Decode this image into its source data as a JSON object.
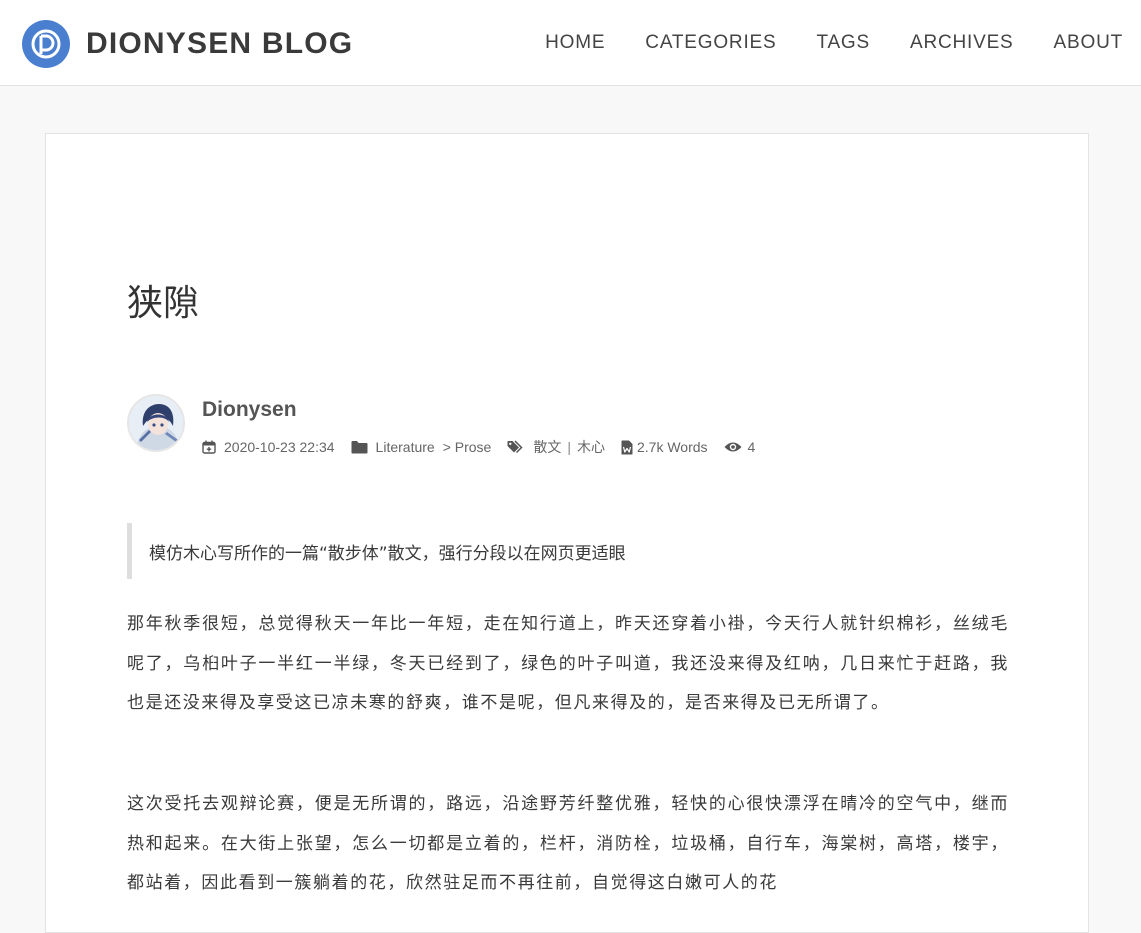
{
  "header": {
    "brand_name": "DIONYSEN BLOG",
    "logo_letter": "D",
    "accent_color": "#4a7fd0",
    "nav": [
      {
        "label": "HOME"
      },
      {
        "label": "CATEGORIES"
      },
      {
        "label": "TAGS"
      },
      {
        "label": "ARCHIVES"
      },
      {
        "label": "ABOUT"
      }
    ]
  },
  "post": {
    "title": "狭隙",
    "author": "Dionysen",
    "avatar_icon": "anime-avatar",
    "meta": {
      "date": "2020-10-23 22:34",
      "category_parent": "Literature",
      "category_child": "> Prose",
      "tags": [
        "散文",
        "木心"
      ],
      "tag_separator": "|",
      "word_count": "2.7k Words",
      "views": "4"
    },
    "quote": "模仿木心写所作的一篇“散步体”散文，强行分段以在网页更适眼",
    "paragraphs": [
      "那年秋季很短，总觉得秋天一年比一年短，走在知行道上，昨天还穿着小褂，今天行人就针织棉衫，丝绒毛呢了，乌桕叶子一半红一半绿，冬天已经到了，绿色的叶子叫道，我还没来得及红呐，几日来忙于赶路，我也是还没来得及享受这已凉未寒的舒爽，谁不是呢，但凡来得及的，是否来得及已无所谓了。",
      "这次受托去观辩论赛，便是无所谓的，路远，沿途野芳纤整优雅，轻快的心很快漂浮在晴冷的空气中，继而热和起来。在大街上张望，怎么一切都是立着的，栏杆，消防栓，垃圾桶，自行车，海棠树，高塔，楼宇，都站着，因此看到一簇躺着的花，欣然驻足而不再往前，自觉得这白嫩可人的花"
    ]
  }
}
